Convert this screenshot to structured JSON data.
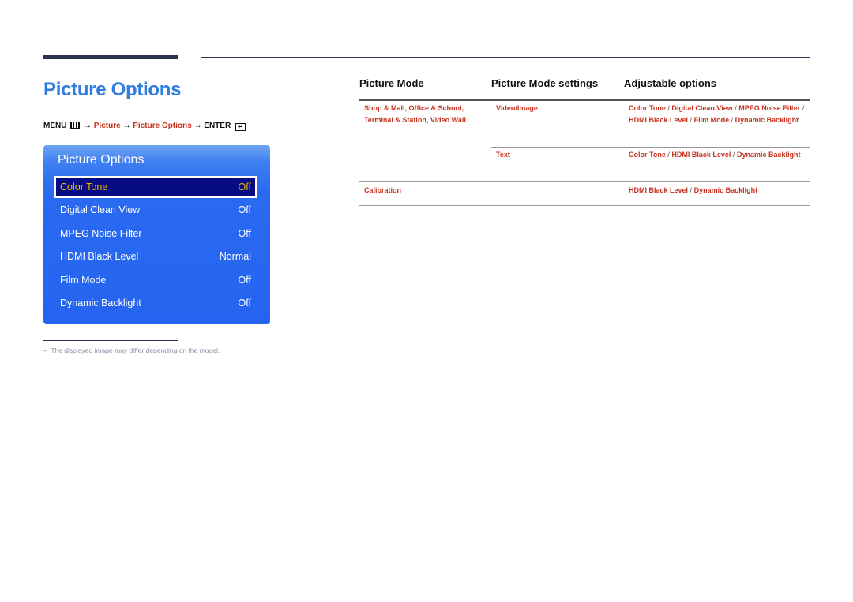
{
  "page": {
    "title": "Picture Options",
    "breadcrumb": {
      "menu": "MENU",
      "menu_icon": "menu-icon",
      "arrow": "→",
      "step1": "Picture",
      "step2": "Picture Options",
      "enter": "ENTER",
      "enter_icon": "enter-icon"
    }
  },
  "osd": {
    "title": "Picture Options",
    "items": [
      {
        "label": "Color Tone",
        "value": "Off",
        "selected": true
      },
      {
        "label": "Digital Clean View",
        "value": "Off"
      },
      {
        "label": "MPEG Noise Filter",
        "value": "Off"
      },
      {
        "label": "HDMI Black Level",
        "value": "Normal"
      },
      {
        "label": "Film Mode",
        "value": "Off"
      },
      {
        "label": "Dynamic Backlight",
        "value": "Off"
      }
    ]
  },
  "footnote": {
    "dash": "–",
    "text": "The displayed image may differ depending on the model."
  },
  "table": {
    "headers": [
      "Picture Mode",
      "Picture Mode settings",
      "Adjustable options"
    ],
    "rows": [
      {
        "mode_line1": "Shop & Mall, Office & School,",
        "mode_line2": "Terminal & Station, Video Wall",
        "settings": "Video/Image",
        "options": [
          "Color Tone",
          "Digital Clean View",
          "MPEG Noise Filter",
          "HDMI Black Level",
          "Film Mode",
          "Dynamic Backlight"
        ]
      },
      {
        "mode": "",
        "settings": "Text",
        "options": [
          "Color Tone",
          "HDMI Black Level",
          "Dynamic Backlight"
        ]
      },
      {
        "mode": "Calibration",
        "settings": "",
        "options": [
          "HDMI Black Level",
          "Dynamic Backlight"
        ]
      }
    ],
    "separator": "/"
  },
  "colors": {
    "title_blue": "#2f7de1",
    "accent_red": "#c8321e",
    "osd_blue": "#2564f0",
    "osd_selected_bg": "#080c84",
    "osd_selected_text": "#f2b800"
  }
}
